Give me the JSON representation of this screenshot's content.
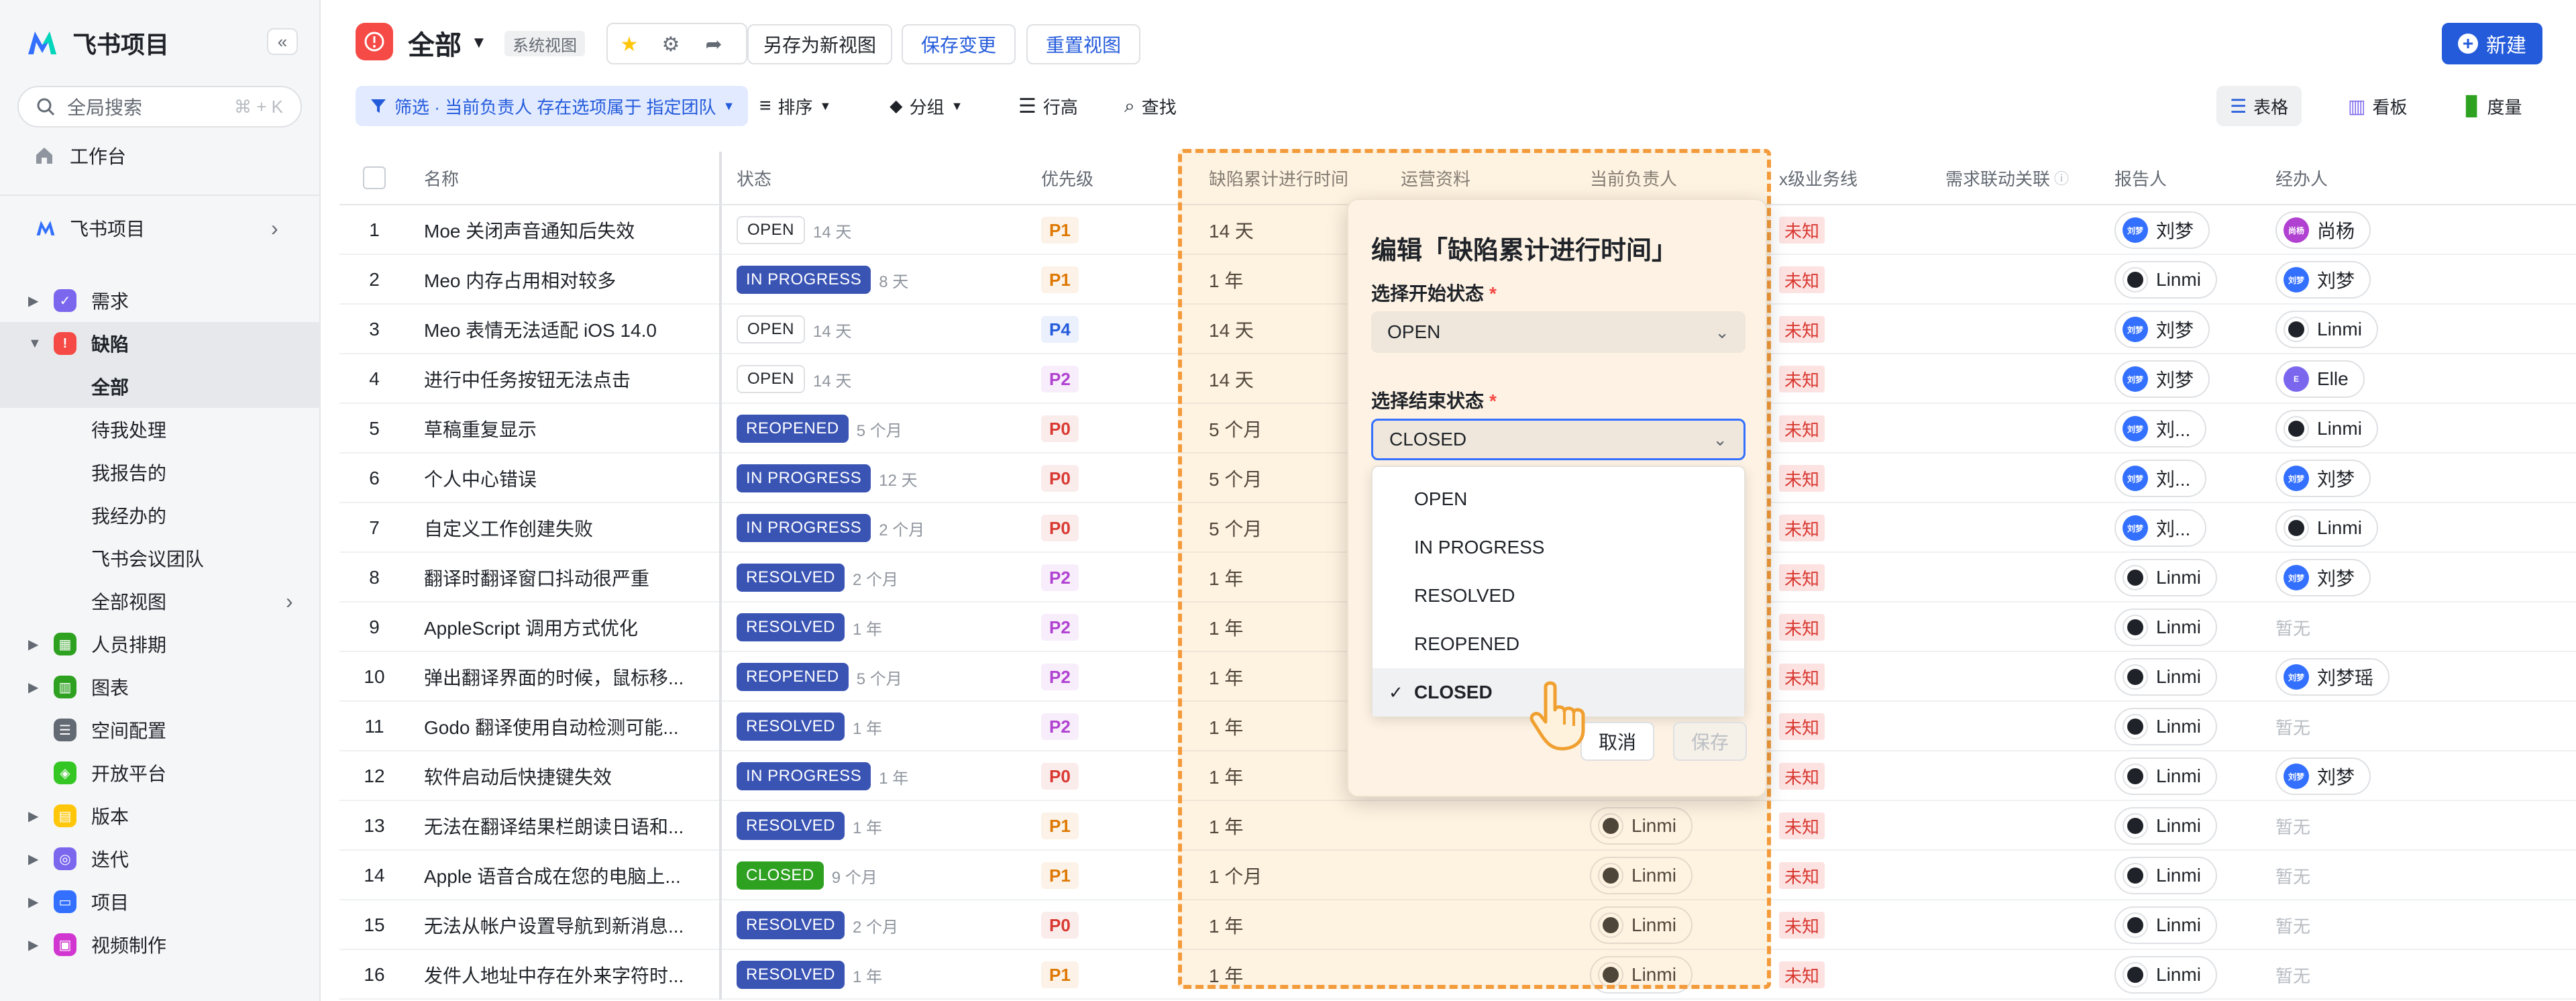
{
  "sidebar": {
    "app_name": "飞书项目",
    "collapse_icon": "«",
    "search_placeholder": "全局搜索",
    "search_shortcut": "⌘ + K",
    "workbench": "工作台",
    "space_name": "飞书项目",
    "nav": [
      {
        "label": "需求",
        "color": "#7b67ee",
        "icon": "✓"
      },
      {
        "label": "缺陷",
        "color": "#f54a45",
        "icon": "!"
      },
      {
        "label": "人员排期",
        "color": "#2ea121",
        "icon": "▦"
      },
      {
        "label": "图表",
        "color": "#2ea121",
        "icon": "▥"
      },
      {
        "label": "空间配置",
        "color": "#646a73",
        "icon": "☰"
      },
      {
        "label": "开放平台",
        "color": "#34c724",
        "icon": "◈"
      },
      {
        "label": "版本",
        "color": "#ffc60a",
        "icon": "▤"
      },
      {
        "label": "迭代",
        "color": "#7b67ee",
        "icon": "◎"
      },
      {
        "label": "项目",
        "color": "#3370ff",
        "icon": "▭"
      },
      {
        "label": "视频制作",
        "color": "#d136d1",
        "icon": "▣"
      }
    ],
    "defect_sub": [
      "全部",
      "待我处理",
      "我报告的",
      "我经办的",
      "飞书会议团队",
      "全部视图"
    ]
  },
  "header": {
    "view_title": "全部",
    "view_tag": "系统视图",
    "save_as": "另存为新视图",
    "save_change": "保存变更",
    "reset": "重置视图",
    "new_btn": "新建"
  },
  "filter_bar": {
    "filter": "筛选 · 当前负责人 存在选项属于 指定团队",
    "sort": "排序",
    "group": "分组",
    "row_height": "行高",
    "find": "查找",
    "views": [
      "表格",
      "看板",
      "度量"
    ]
  },
  "columns": [
    "名称",
    "状态",
    "优先级",
    "缺陷累计进行时间",
    "运营资料",
    "当前负责人",
    "x级业务线",
    "需求联动关联",
    "报告人",
    "经办人"
  ],
  "rows": [
    {
      "no": "1",
      "name": "Moe 关闭声音通知后失效",
      "status": "OPEN",
      "ago": "14 天",
      "pri": "P1",
      "time": "14 天",
      "owner": "",
      "biz": "未知",
      "reporter": "刘梦",
      "assignee": "尚杨"
    },
    {
      "no": "2",
      "name": "Meo 内存占用相对较多",
      "status": "IN PROGRESS",
      "ago": "8 天",
      "pri": "P1",
      "time": "1 年",
      "owner": "",
      "biz": "未知",
      "reporter": "Linmi",
      "assignee": "刘梦"
    },
    {
      "no": "3",
      "name": "Meo 表情无法适配 iOS 14.0",
      "status": "OPEN",
      "ago": "14 天",
      "pri": "P4",
      "time": "14 天",
      "owner": "",
      "biz": "未知",
      "reporter": "刘梦",
      "assignee": "Linmi"
    },
    {
      "no": "4",
      "name": "进行中任务按钮无法点击",
      "status": "OPEN",
      "ago": "14 天",
      "pri": "P2",
      "time": "14 天",
      "owner": "",
      "biz": "未知",
      "reporter": "刘梦",
      "assignee": "Elle"
    },
    {
      "no": "5",
      "name": "草稿重复显示",
      "status": "REOPENED",
      "ago": "5 个月",
      "pri": "P0",
      "time": "5 个月",
      "owner": "",
      "biz": "未知",
      "reporter": "刘...",
      "assignee": "Linmi"
    },
    {
      "no": "6",
      "name": "个人中心错误",
      "status": "IN PROGRESS",
      "ago": "12 天",
      "pri": "P0",
      "time": "5 个月",
      "owner": "",
      "biz": "未知",
      "reporter": "刘...",
      "assignee": "刘梦"
    },
    {
      "no": "7",
      "name": "自定义工作创建失败",
      "status": "IN PROGRESS",
      "ago": "2 个月",
      "pri": "P0",
      "time": "5 个月",
      "owner": "",
      "biz": "未知",
      "reporter": "刘...",
      "assignee": "Linmi"
    },
    {
      "no": "8",
      "name": "翻译时翻译窗口抖动很严重",
      "status": "RESOLVED",
      "ago": "2 个月",
      "pri": "P2",
      "time": "1 年",
      "owner": "",
      "biz": "未知",
      "reporter": "Linmi",
      "assignee": "刘梦"
    },
    {
      "no": "9",
      "name": "AppleScript 调用方式优化",
      "status": "RESOLVED",
      "ago": "1 年",
      "pri": "P2",
      "time": "1 年",
      "owner": "",
      "biz": "未知",
      "reporter": "Linmi",
      "assignee": "暂无"
    },
    {
      "no": "10",
      "name": "弹出翻译界面的时候，鼠标移...",
      "status": "REOPENED",
      "ago": "5 个月",
      "pri": "P2",
      "time": "1 年",
      "owner": "",
      "biz": "未知",
      "reporter": "Linmi",
      "assignee": "刘梦瑶"
    },
    {
      "no": "11",
      "name": "Godo 翻译使用自动检测可能...",
      "status": "RESOLVED",
      "ago": "1 年",
      "pri": "P2",
      "time": "1 年",
      "owner": "",
      "biz": "未知",
      "reporter": "Linmi",
      "assignee": "暂无"
    },
    {
      "no": "12",
      "name": "软件启动后快捷键失效",
      "status": "IN PROGRESS",
      "ago": "1 年",
      "pri": "P0",
      "time": "1 年",
      "owner": "",
      "biz": "未知",
      "reporter": "Linmi",
      "assignee": "刘梦"
    },
    {
      "no": "13",
      "name": "无法在翻译结果栏朗读日语和...",
      "status": "RESOLVED",
      "ago": "1 年",
      "pri": "P1",
      "time": "1 年",
      "owner": "Linmi",
      "biz": "未知",
      "reporter": "Linmi",
      "assignee": "暂无"
    },
    {
      "no": "14",
      "name": "Apple 语音合成在您的电脑上...",
      "status": "CLOSED",
      "ago": "9 个月",
      "pri": "P1",
      "time": "1 个月",
      "owner": "Linmi",
      "biz": "未知",
      "reporter": "Linmi",
      "assignee": "暂无"
    },
    {
      "no": "15",
      "name": "无法从帐户设置导航到新消息...",
      "status": "RESOLVED",
      "ago": "2 个月",
      "pri": "P0",
      "time": "1 年",
      "owner": "Linmi",
      "biz": "未知",
      "reporter": "Linmi",
      "assignee": "暂无"
    },
    {
      "no": "16",
      "name": "发件人地址中存在外来字符时...",
      "status": "RESOLVED",
      "ago": "1 年",
      "pri": "P1",
      "time": "1 年",
      "owner": "Linmi",
      "biz": "未知",
      "reporter": "Linmi",
      "assignee": "暂无"
    }
  ],
  "status_colors": {
    "OPEN": "#ffffff",
    "IN PROGRESS": "#3a54b4",
    "REOPENED": "#3a54b4",
    "RESOLVED": "#3a54b4",
    "CLOSED": "#2ea121"
  },
  "priority_colors": {
    "P0": "#d83931",
    "P1": "#de7802",
    "P2": "#b041d1",
    "P4": "#245bdb"
  },
  "popup": {
    "title": "编辑「缺陷累计进行时间」",
    "start_label": "选择开始状态",
    "start_value": "OPEN",
    "end_label": "选择结束状态",
    "end_value": "CLOSED",
    "required_mark": "*",
    "options": [
      "OPEN",
      "IN PROGRESS",
      "RESOLVED",
      "REOPENED",
      "CLOSED"
    ],
    "selected_option": "CLOSED",
    "cancel": "取消",
    "save": "保存"
  }
}
